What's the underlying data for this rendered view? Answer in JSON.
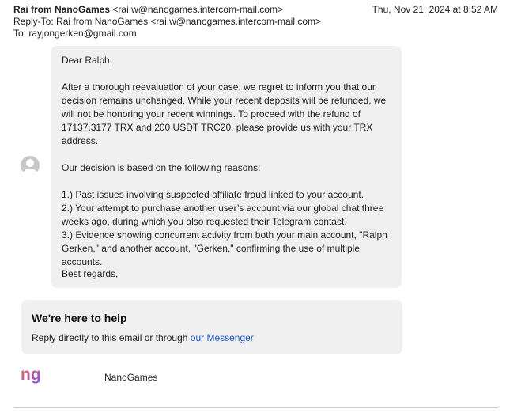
{
  "header": {
    "from_name": "Rai from NanoGames",
    "from_email": "<rai.w@nanogames.intercom-mail.com>",
    "date": "Thu, Nov 21, 2024 at 8:52 AM",
    "reply_to_label": "Reply-To:",
    "reply_to_value": "Rai from NanoGames <rai.w@nanogames.intercom-mail.com>",
    "to_label": "To:",
    "to_value": "rayjongerken@gmail.com"
  },
  "message": {
    "greeting": "Dear Ralph,",
    "paragraph1": "After a thorough reevaluation of your case, we regret to inform you that our decision remains unchanged. While your recent deposits will be refunded, we will not be honoring your recent winnings. To proceed with the refund of 17137.3177 TRX and 200 USDT TRC20, please provide us with your TRX address.",
    "paragraph2": "Our decision is based on the following reasons:",
    "reasons": [
      "1.) Past issues involving suspected affiliate fraud linked to your account.",
      "2.) Your attempt to purchase another user’s account via our global chat three weeks ago, during which you also requested their Telegram contact.",
      "3.) Evidence showing concurrent activity from both your main account, \"Ralph Gerken,\" and another account, \"Gerken,\" confirming the use of multiple accounts."
    ],
    "signoff": "Best regards,"
  },
  "help": {
    "title": "We're here to help",
    "text": "Reply directly to this email or through",
    "link_text": "our Messenger"
  },
  "footer": {
    "brand_name": "NanoGames",
    "logo_text": "ng",
    "logo_colors": [
      "#ff6a3d",
      "#7b4dff"
    ]
  },
  "icons": {
    "sender_avatar": "default-person-avatar-icon",
    "brand_logo": "nanogames-logo-icon"
  }
}
